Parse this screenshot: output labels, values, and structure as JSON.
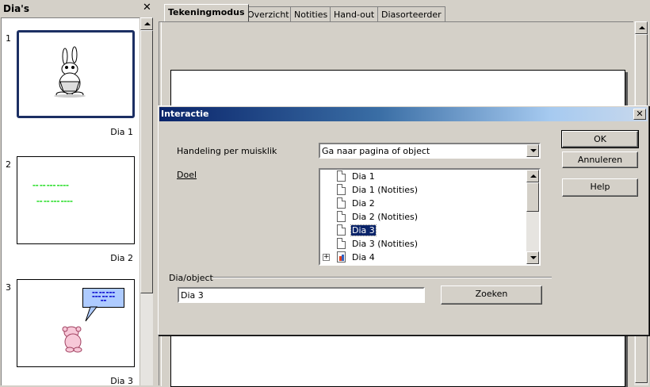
{
  "slides_pane": {
    "title": "Dia's",
    "close_glyph": "✕",
    "slides": [
      {
        "number": "1",
        "name": "Dia 1"
      },
      {
        "number": "2",
        "name": "Dia 2"
      },
      {
        "number": "3",
        "name": "Dia 3"
      }
    ]
  },
  "tabs": [
    "Tekeningmodus",
    "Overzicht",
    "Notities",
    "Hand-out",
    "Diasorteerder"
  ],
  "dialog": {
    "title": "Interactie",
    "close_glyph": "✕",
    "action_label": "Handeling per muisklik",
    "action_value": "Ga naar pagina of object",
    "target_label": "Doel",
    "target_items": [
      {
        "label": "Dia 1",
        "icon": "document-icon"
      },
      {
        "label": "Dia 1 (Notities)",
        "icon": "document-icon"
      },
      {
        "label": "Dia 2",
        "icon": "document-icon"
      },
      {
        "label": "Dia 2 (Notities)",
        "icon": "document-icon"
      },
      {
        "label": "Dia 3",
        "icon": "document-icon",
        "selected": true
      },
      {
        "label": "Dia 3 (Notities)",
        "icon": "document-icon"
      },
      {
        "label": "Dia 4",
        "icon": "presentation-icon",
        "expandable": true
      }
    ],
    "slide_object_label": "Dia/object",
    "slide_object_value": "Dia 3",
    "search_button": "Zoeken",
    "ok_button": "OK",
    "cancel_button": "Annuleren",
    "help_button": "Help"
  },
  "colors": {
    "titlebar_start": "#0a246a",
    "titlebar_end": "#a6caf0",
    "selection": "#0a246a",
    "active_slide_border": "#1c2f63"
  }
}
